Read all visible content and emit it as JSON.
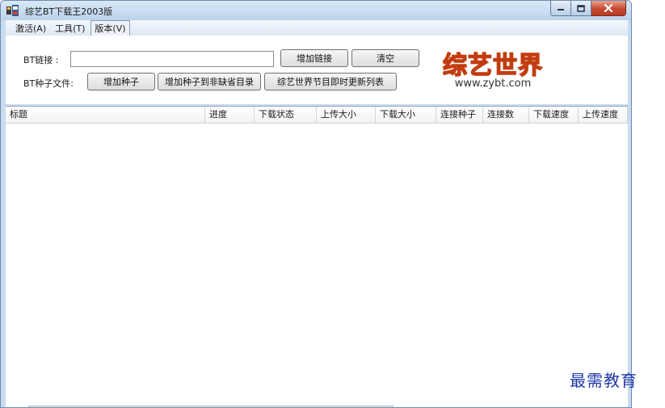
{
  "window": {
    "title": "综艺BT下载王2003版"
  },
  "menu": [
    {
      "label": "激活(A)",
      "active": false
    },
    {
      "label": "工具(T)",
      "active": false
    },
    {
      "label": "版本(V)",
      "active": true
    }
  ],
  "bt_link": {
    "label": "BT链接 :",
    "value": ""
  },
  "seed_file": {
    "label": "BT种子文件:"
  },
  "buttons": {
    "add_link": "增加链接",
    "clear": "清空",
    "add_seed": "增加种子",
    "add_seed_default": "增加种子到非缺省目录",
    "refresh_list": "综艺世界节目即时更新列表"
  },
  "logo": {
    "main": "综艺世界",
    "url": "www.zybt.com"
  },
  "columns": [
    "标题",
    "进度",
    "下载状态",
    "上传大小",
    "下载大小",
    "连接种子",
    "连接数",
    "下载速度",
    "上传速度"
  ],
  "watermark": "最需教育",
  "colors": {
    "logo_fill": "#f5b800",
    "logo_stroke": "#c23c10",
    "watermark": "#1f3aa8",
    "close_button": "#c44a31"
  }
}
